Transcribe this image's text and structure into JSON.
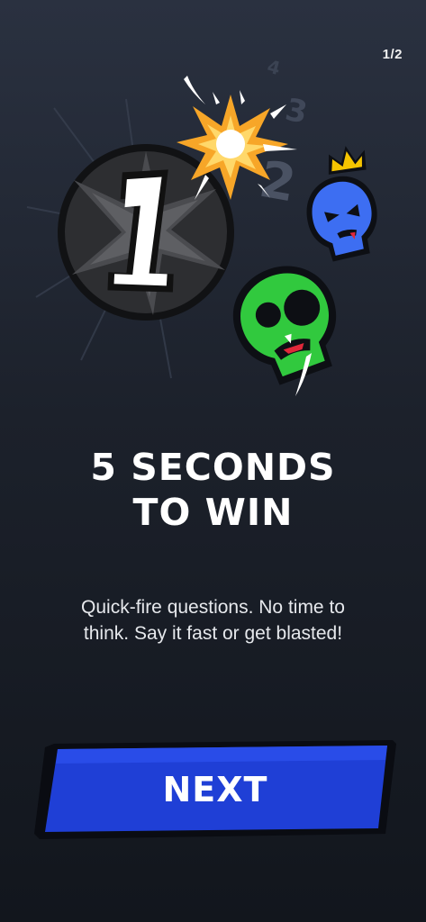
{
  "pager": {
    "text": "1/2"
  },
  "illustration": {
    "bomb_number": "1",
    "countdown_digits": [
      "2",
      "3",
      "4"
    ],
    "icons": [
      "bomb-icon",
      "explosion-spark-icon",
      "blue-skull-crown-icon",
      "green-skull-icon"
    ],
    "colors": {
      "bomb": "#2e2e30",
      "spark": "#f7a628",
      "blue_skull": "#3d6ef2",
      "crown": "#f5c400",
      "green_skull": "#31c93e"
    }
  },
  "onboarding": {
    "title_line1": "5 SECONDS",
    "title_line2": "TO WIN",
    "desc_line1": "Quick-fire questions. No time to",
    "desc_line2": "think. Say it fast or get blasted!"
  },
  "actions": {
    "next_label": "NEXT",
    "button_color": "#1f3fd6"
  }
}
